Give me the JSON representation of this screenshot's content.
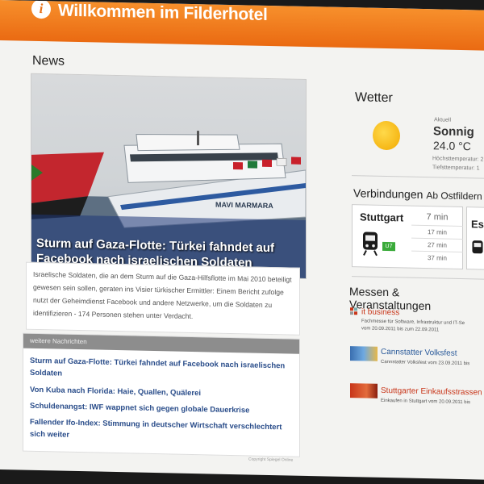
{
  "header": {
    "title": "Willkommen im Filderhotel",
    "info_icon": "i"
  },
  "news": {
    "section_title": "News",
    "headline": "Sturm auf Gaza-Flotte: Türkei fahndet auf Facebook nach israelischen Soldaten",
    "ship_name": "MAVI MARMARA",
    "teaser": "Israelische Soldaten, die an dem Sturm auf die Gaza-Hilfsflotte im Mai 2010 beteiligt gewesen sein sollen, geraten ins Visier türkischer Ermittler: Einem Bericht zufolge nutzt der Geheimdienst Facebook und andere Netzwerke, um die Soldaten zu identifizieren - 174 Personen stehen unter Verdacht.",
    "more_title": "weitere Nachrichten",
    "more_items": [
      "Sturm auf Gaza-Flotte: Türkei fahndet auf Facebook nach israelischen Soldaten",
      "Von Kuba nach Florida: Haie, Quallen, Quälerei",
      "Schuldenangst: IWF wappnet sich gegen globale Dauerkrise",
      "Fallender Ifo-Index: Stimmung in deutscher Wirtschaft verschlechtert sich weiter"
    ],
    "copyright": "Copyright Spiegel Online"
  },
  "weather": {
    "title": "Wetter",
    "icon": "sun-icon",
    "current_label": "Aktuell",
    "condition": "Sonnig",
    "temperature": "24.0 °C",
    "max_label": "Höchsttemperatur: 2",
    "min_label": "Tiefsttemperatur: 1"
  },
  "connections": {
    "title": "Verbindungen",
    "subtitle": "Ab Ostfildern",
    "cards": [
      {
        "city": "Stuttgart",
        "line": "U7",
        "times": [
          "7 min",
          "17 min",
          "27 min",
          "37 min"
        ]
      },
      {
        "city": "Es"
      }
    ]
  },
  "events": {
    "title": "Messen & Veranstaltungen",
    "items": [
      {
        "title": "it business",
        "sub1": "Fachmesse für Software, Infrastruktur und IT-Se",
        "sub2": "vom 20.09.2011 bis zum 22.09.2011"
      },
      {
        "title": "Cannstatter Volksfest",
        "sub1": "Cannstatter Volksfest vom 23.09.2011 bis"
      },
      {
        "title": "Stuttgarter Einkaufsstrassen",
        "sub1": "Einkaufen in Stuttgart vom 20.09.2011 bis"
      }
    ]
  }
}
